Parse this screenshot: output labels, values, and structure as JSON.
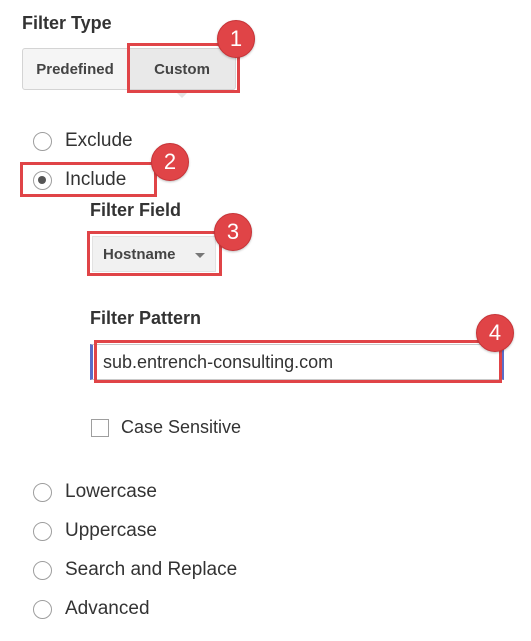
{
  "filter_type": {
    "title": "Filter Type",
    "options": [
      "Predefined",
      "Custom"
    ],
    "selected": "Custom"
  },
  "radio_options": {
    "exclude": "Exclude",
    "include": "Include",
    "lowercase": "Lowercase",
    "uppercase": "Uppercase",
    "search_replace": "Search and Replace",
    "advanced": "Advanced",
    "selected": "Include"
  },
  "filter_field": {
    "label": "Filter Field",
    "value": "Hostname"
  },
  "filter_pattern": {
    "label": "Filter Pattern",
    "value": "sub.entrench-consulting.com"
  },
  "case_sensitive": {
    "label": "Case Sensitive",
    "checked": false
  },
  "callouts": {
    "c1": "1",
    "c2": "2",
    "c3": "3",
    "c4": "4",
    "color": "#e04447"
  },
  "colors": {
    "input_accent": "#5b6cc7"
  }
}
